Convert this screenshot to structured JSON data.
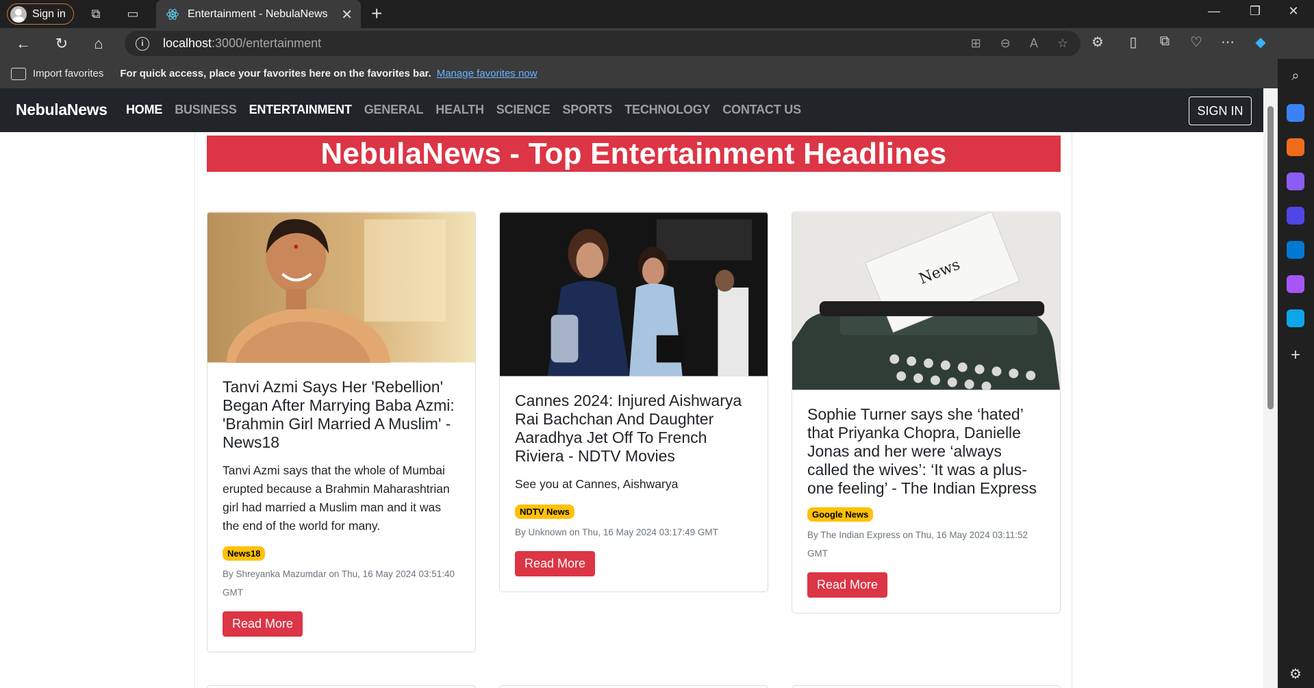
{
  "browser": {
    "signin_label": "Sign in",
    "tab_title": "Entertainment - NebulaNews",
    "url_host": "localhost",
    "url_path": ":3000/entertainment",
    "favbar": {
      "import_label": "Import favorites",
      "tip": "For quick access, place your favorites here on the favorites bar.",
      "manage_link": "Manage favorites now"
    }
  },
  "navbar": {
    "brand": "NebulaNews",
    "links": [
      {
        "label": "HOME",
        "active": true
      },
      {
        "label": "BUSINESS",
        "active": false
      },
      {
        "label": "ENTERTAINMENT",
        "active": true
      },
      {
        "label": "GENERAL",
        "active": false
      },
      {
        "label": "HEALTH",
        "active": false
      },
      {
        "label": "SCIENCE",
        "active": false
      },
      {
        "label": "SPORTS",
        "active": false
      },
      {
        "label": "TECHNOLOGY",
        "active": false
      },
      {
        "label": "CONTACT US",
        "active": false
      }
    ],
    "signin": "SIGN IN"
  },
  "page": {
    "heading": "NebulaNews - Top Entertainment Headlines"
  },
  "cards": [
    {
      "title": "Tanvi Azmi Says Her 'Rebellion' Began After Marrying Baba Azmi: 'Brahmin Girl Married A Muslim' - News18",
      "description": "Tanvi Azmi says that the whole of Mumbai erupted because a Brahmin Maharashtrian girl had married a Muslim man and it was the end of the world for many.",
      "source": "News18",
      "meta": "By Shreyanka Mazumdar on Thu, 16 May 2024 03:51:40 GMT",
      "button": "Read More"
    },
    {
      "title": "Cannes 2024: Injured Aishwarya Rai Bachchan And Daughter Aaradhya Jet Off To French Riviera - NDTV Movies",
      "description": "See you at Cannes, Aishwarya",
      "source": "NDTV News",
      "meta": "By Unknown on Thu, 16 May 2024 03:17:49 GMT",
      "button": "Read More"
    },
    {
      "title": "Sophie Turner says she ‘hated’ that Priyanka Chopra, Danielle Jonas and her were ‘always called the wives’: ‘It was a plus-one feeling’ - The Indian Express",
      "description": "",
      "source": "Google News",
      "meta": "By The Indian Express on Thu, 16 May 2024 03:11:52 GMT",
      "button": "Read More"
    }
  ],
  "colors": {
    "accent": "#dc3545",
    "badge": "#ffc107",
    "navbar": "#212529"
  }
}
